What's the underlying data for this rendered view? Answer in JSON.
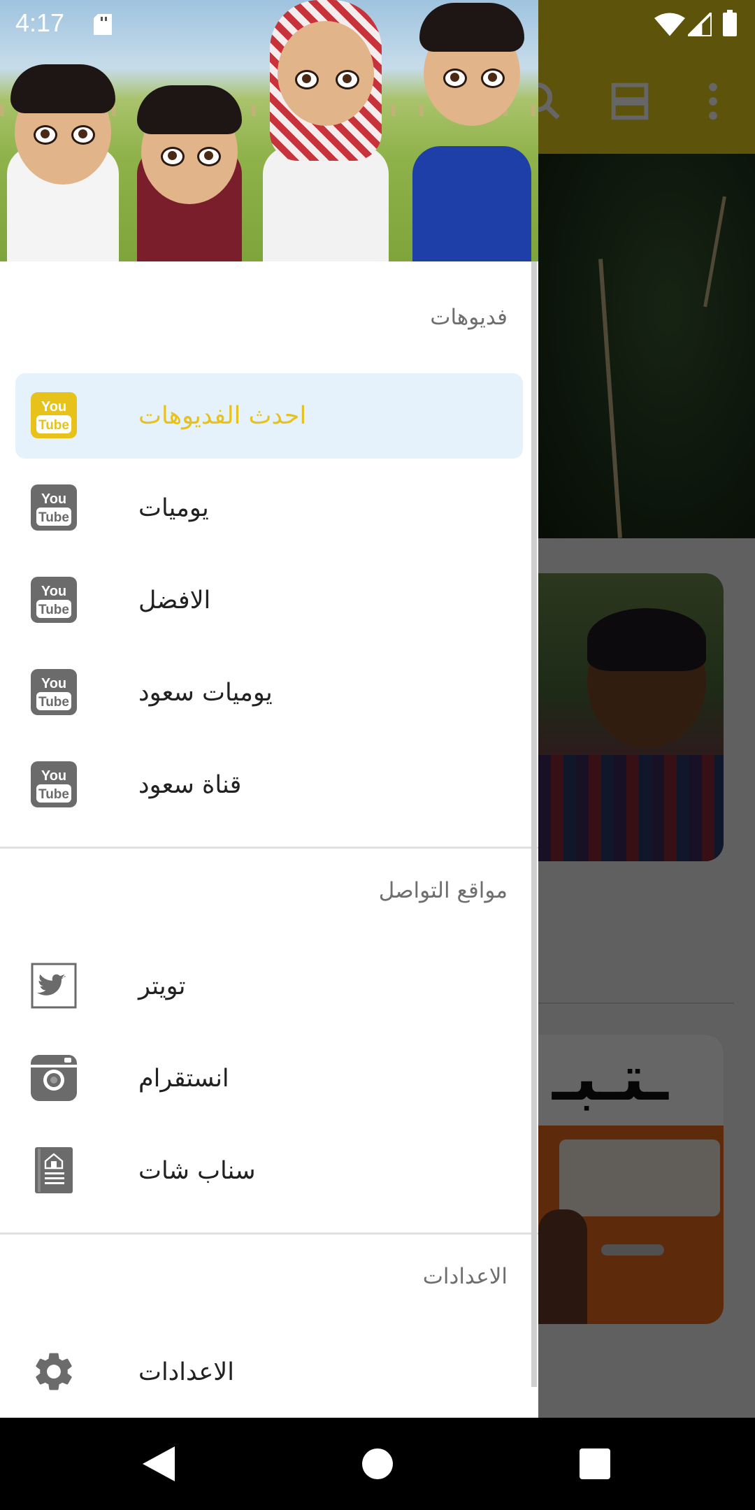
{
  "status_bar": {
    "time": "4:17",
    "icons": [
      "sd-card-icon",
      "wifi-icon",
      "signal-icon",
      "battery-icon"
    ]
  },
  "app_bar": {
    "color": "#e8cf1a",
    "actions": [
      "search-icon",
      "view-toggle-icon",
      "more-vert-icon"
    ]
  },
  "drawer": {
    "header_image": "cartoon-characters-header",
    "sections": [
      {
        "title": "فديوهات",
        "items": [
          {
            "label": "احدث الفديوهات",
            "icon": "youtube-icon",
            "active": true
          },
          {
            "label": "يوميات",
            "icon": "youtube-icon",
            "active": false
          },
          {
            "label": "الافضل",
            "icon": "youtube-icon",
            "active": false
          },
          {
            "label": "يوميات سعود",
            "icon": "youtube-icon",
            "active": false
          },
          {
            "label": "قناة سعود",
            "icon": "youtube-icon",
            "active": false
          }
        ]
      },
      {
        "title": "مواقع التواصل",
        "items": [
          {
            "label": "تويتر",
            "icon": "twitter-icon"
          },
          {
            "label": "انستقرام",
            "icon": "instagram-icon"
          },
          {
            "label": "سناب شات",
            "icon": "snapchat-icon"
          }
        ]
      },
      {
        "title": "الاعدادات",
        "items": [
          {
            "label": "الاعدادات",
            "icon": "gear-icon"
          }
        ]
      }
    ]
  },
  "colors": {
    "accent": "#e6c21a",
    "active_item_bg": "#e5f1fb",
    "icon_gray": "#6b6b6b"
  },
  "nav_bar": {
    "buttons": [
      "back-icon",
      "home-icon",
      "recents-icon"
    ]
  }
}
